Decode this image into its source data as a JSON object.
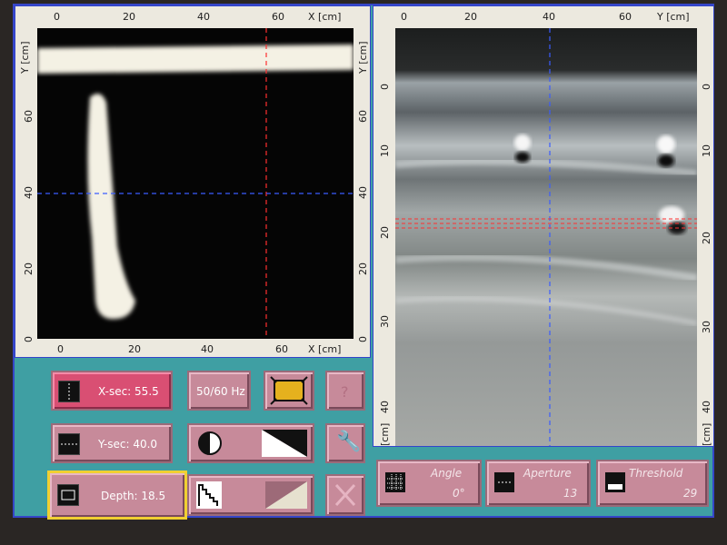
{
  "left_view": {
    "top_axis_title": "X [cm]",
    "top_ticks": [
      "0",
      "20",
      "40",
      "60"
    ],
    "bottom_axis_title": "X [cm]",
    "bottom_ticks": [
      "0",
      "20",
      "40",
      "60"
    ],
    "left_axis_title": "Y [cm]",
    "left_ticks": [
      "60",
      "40",
      "20",
      "0"
    ],
    "right_axis_title": "Y [cm]",
    "right_ticks": [
      "60",
      "40",
      "20",
      "0"
    ]
  },
  "right_view": {
    "top_axis_title": "Y [cm]",
    "top_ticks": [
      "0",
      "20",
      "40",
      "60"
    ],
    "left_ticks": [
      "0",
      "10",
      "20",
      "30",
      "40"
    ],
    "left_axis_title": "[cm]",
    "right_ticks": [
      "0",
      "10",
      "20",
      "30",
      "40"
    ],
    "right_axis_title": "[cm]"
  },
  "controls": {
    "xsec_label": "X-sec: 55.5",
    "ysec_label": "Y-sec: 40.0",
    "depth_label": "Depth: 18.5",
    "freq_label": "50/60 Hz",
    "question_label": "?",
    "angle_label": "Angle",
    "angle_value": "0°",
    "aperture_label": "Aperture",
    "aperture_value": "13",
    "threshold_label": "Threshold",
    "threshold_value": "29"
  },
  "colors": {
    "background": "#3f9fa3",
    "button": "#c78a9a",
    "button_active": "#d94f73",
    "highlight_border": "#f0d032",
    "crosshair_red": "#ff3030",
    "crosshair_blue": "#3a5cff"
  }
}
